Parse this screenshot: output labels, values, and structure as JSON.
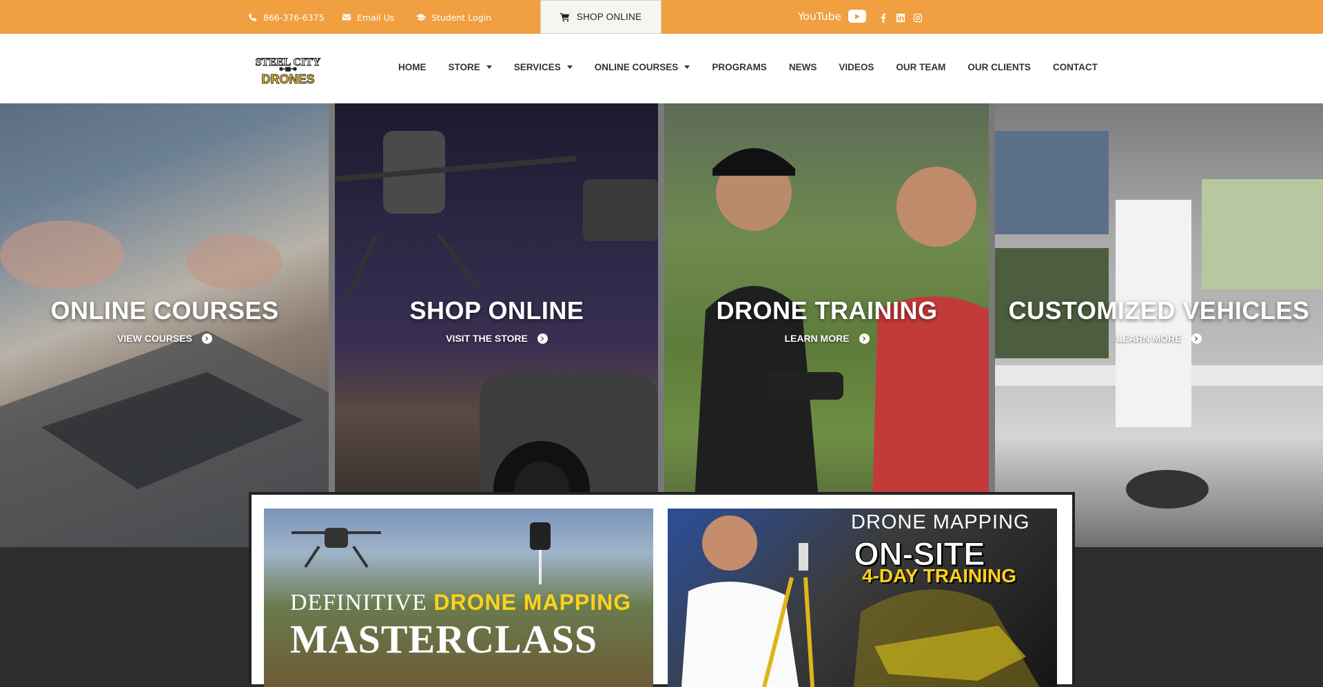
{
  "topbar": {
    "phone": "866-376-6375",
    "email": "Email Us",
    "student_login": "Student Login",
    "shop_online": "SHOP ONLINE",
    "youtube_label": "YouTube"
  },
  "logo": {
    "line1": "STEEL CITY",
    "line2": "DRONES"
  },
  "nav": {
    "items": [
      {
        "label": "HOME"
      },
      {
        "label": "STORE"
      },
      {
        "label": "SERVICES"
      },
      {
        "label": "ONLINE COURSES"
      },
      {
        "label": "PROGRAMS"
      },
      {
        "label": "NEWS"
      },
      {
        "label": "VIDEOS"
      },
      {
        "label": "OUR TEAM"
      },
      {
        "label": "OUR CLIENTS"
      },
      {
        "label": "CONTACT"
      }
    ]
  },
  "hero": {
    "panels": [
      {
        "title": "ONLINE COURSES",
        "link": "VIEW COURSES"
      },
      {
        "title": "SHOP ONLINE",
        "link": "VISIT THE STORE"
      },
      {
        "title": "DRONE TRAINING",
        "link": "LEARN MORE"
      },
      {
        "title": "CUSTOMIZED VEHICLES",
        "link": "LEARN MORE"
      }
    ]
  },
  "banners": {
    "masterclass": {
      "line1a": "DEFINITIVE ",
      "line1b": "DRONE MAPPING",
      "line2": "MASTERCLASS"
    },
    "training": {
      "line1": "DRONE MAPPING",
      "line2": "ON-SITE",
      "line3": "4-DAY TRAINING"
    }
  },
  "colors": {
    "topbar": "#f0a040",
    "accent_yellow": "#ffd21a",
    "dark": "#2d2d2d"
  }
}
